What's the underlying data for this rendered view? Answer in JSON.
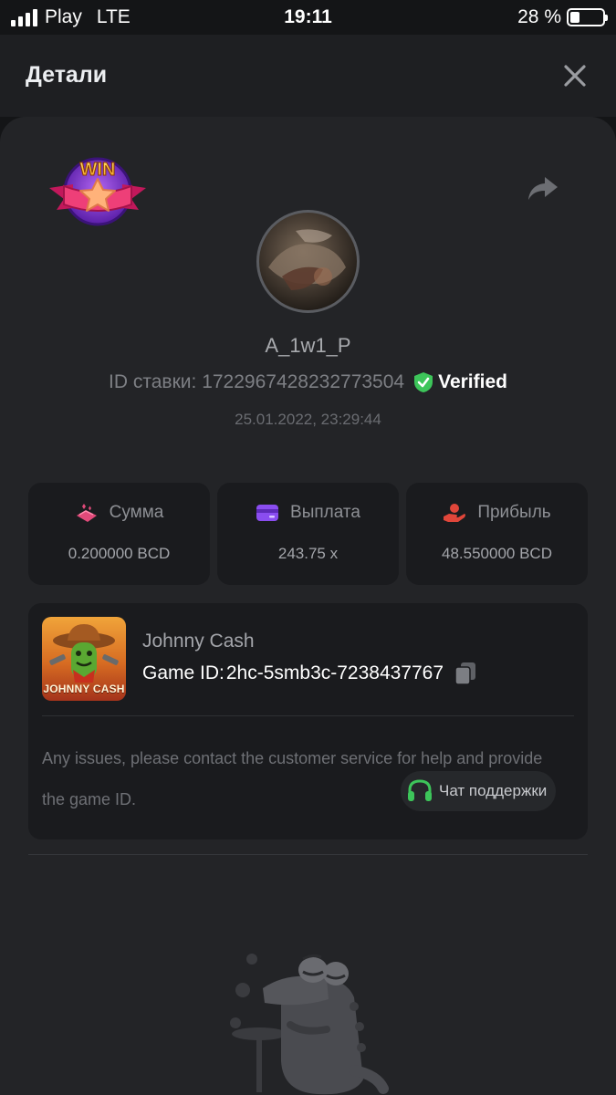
{
  "status_bar": {
    "carrier": "Play",
    "network": "LTE",
    "time": "19:11",
    "battery_text": "28 %",
    "battery_level": 0.28
  },
  "header": {
    "title": "Детали"
  },
  "bet": {
    "win_badge_text": "WIN",
    "username": "A_1w1_P",
    "bet_id_label": "ID ставки:",
    "bet_id": "172296742823277350​4",
    "verified_label": "Verified",
    "date": "25.01.2022, 23:29:44"
  },
  "stats": [
    {
      "label": "Сумма",
      "value": "0.200000 BCD",
      "icon": "bet-amount-icon",
      "color": "#e14a7a"
    },
    {
      "label": "Выплата",
      "value": "243.75 x",
      "icon": "card-icon",
      "color": "#8a4df0"
    },
    {
      "label": "Прибыль",
      "value": "48.550000 BCD",
      "icon": "profit-hand-icon",
      "color": "#e0463a"
    }
  ],
  "game": {
    "thumbnail_text": "JOHNNY CASH",
    "name": "Johnny Cash",
    "id_label": "Game ID:",
    "id_value": "2hc-5smb3c-7238437767",
    "help_text": "Any issues, please contact the customer service for help and provide the game ID.",
    "support_label": "Чат поддержки"
  },
  "colors": {
    "background": "#141517",
    "card": "#232427",
    "panel": "#1a1b1e",
    "verified_green": "#3dc55a",
    "support_green": "#3dc55a"
  }
}
